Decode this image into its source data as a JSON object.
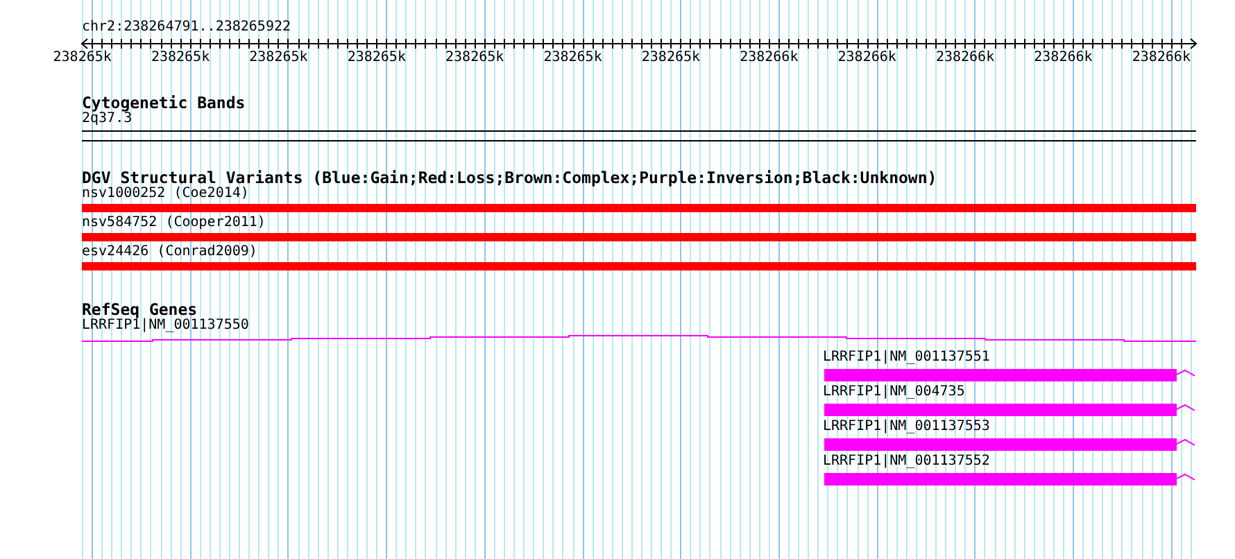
{
  "ruler": {
    "region": "chr2:238264791..238265922",
    "tick_labels": [
      "238265k",
      "238265k",
      "238265k",
      "238265k",
      "238265k",
      "238265k",
      "238265k",
      "238266k",
      "238266k",
      "238266k",
      "238266k",
      "238266k"
    ]
  },
  "tracks": [
    {
      "kind": "band",
      "title": "Cytogenetic Bands",
      "items": [
        {
          "label": "2q37.3"
        }
      ]
    },
    {
      "kind": "variants",
      "title": "DGV Structural Variants (Blue:Gain;Red:Loss;Brown:Complex;Purple:Inversion;Black:Unknown)",
      "items": [
        {
          "label": "nsv1000252 (Coe2014)",
          "color": "#ff0000"
        },
        {
          "label": "nsv584752 (Cooper2011)",
          "color": "#ff0000"
        },
        {
          "label": "esv24426 (Conrad2009)",
          "color": "#ff0000"
        }
      ]
    },
    {
      "kind": "genes",
      "title": "RefSeq Genes",
      "items": [
        {
          "kind": "gene_line",
          "label": "LRRFIP1|NM_001137550"
        },
        {
          "kind": "transcript",
          "label": "LRRFIP1|NM_001137551"
        },
        {
          "kind": "transcript",
          "label": "LRRFIP1|NM_004735"
        },
        {
          "kind": "transcript",
          "label": "LRRFIP1|NM_001137553"
        },
        {
          "kind": "transcript",
          "label": "LRRFIP1|NM_001137552"
        }
      ]
    }
  ]
}
